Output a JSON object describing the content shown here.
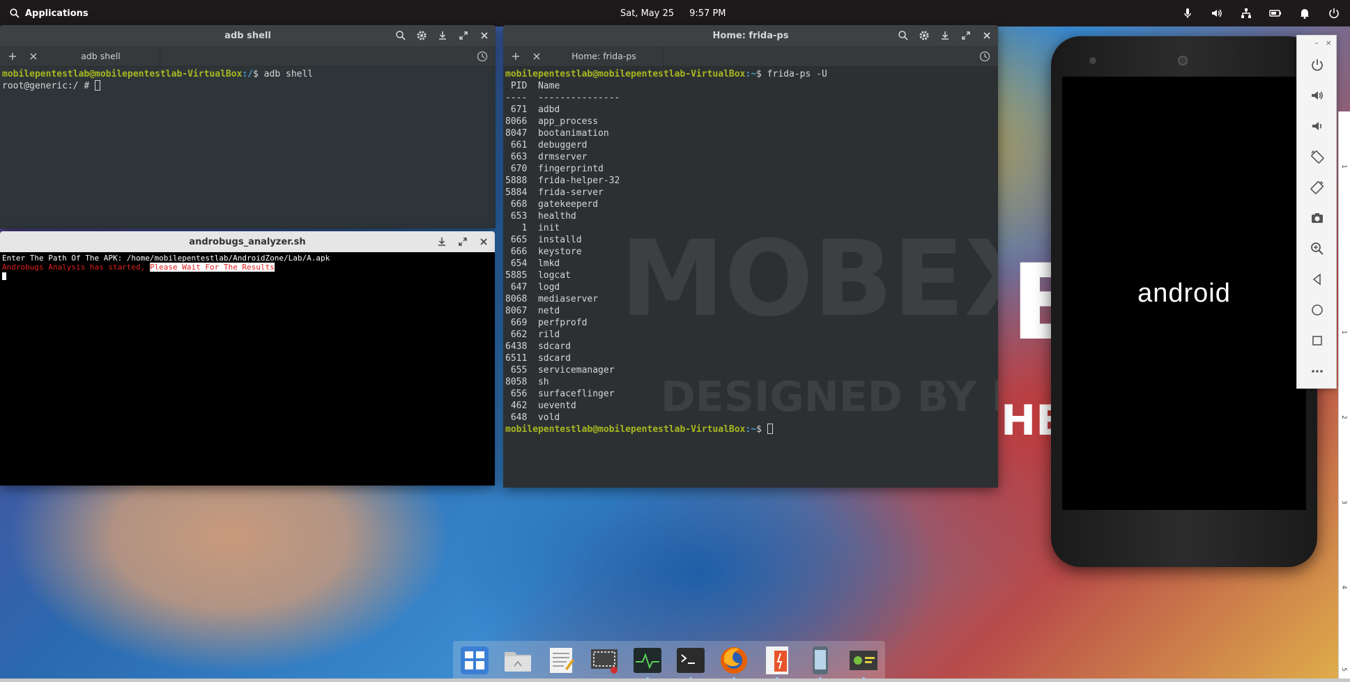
{
  "top_panel": {
    "apps_label": "Applications",
    "date": "Sat, May 25",
    "time": "9:57 PM",
    "tray_icons": [
      "microphone-icon",
      "volume-icon",
      "network-icon",
      "battery-icon",
      "notification-bell-icon",
      "power-icon"
    ]
  },
  "adb_window": {
    "title": "adb shell",
    "tab_label": "adb shell",
    "prompt_user": "mobilepentestlab@mobilepentestlab-VirtualBox",
    "prompt_path": ":/",
    "command": "$ adb shell",
    "root_prompt": "root@generic:/ # "
  },
  "andro_window": {
    "title": "androbugs_analyzer.sh",
    "line1": "Enter The Path Of The APK: /home/mobilepentestlab/AndroidZone/Lab/A.apk",
    "line2_red": "Androbugs Analysis has started, ",
    "line2_highlight": "Please Wait For The Results"
  },
  "frida_window": {
    "title": "Home: frida-ps",
    "tab_label": "Home: frida-ps",
    "prompt_user": "mobilepentestlab@mobilepentestlab-VirtualBox",
    "prompt_path": ":~",
    "command": "$ frida-ps -U",
    "header_pid": "PID",
    "header_name": "Name",
    "separator": "----  ---------------",
    "processes": [
      {
        "pid": "671",
        "name": "adbd"
      },
      {
        "pid": "8066",
        "name": "app_process"
      },
      {
        "pid": "8047",
        "name": "bootanimation"
      },
      {
        "pid": "661",
        "name": "debuggerd"
      },
      {
        "pid": "663",
        "name": "drmserver"
      },
      {
        "pid": "670",
        "name": "fingerprintd"
      },
      {
        "pid": "5888",
        "name": "frida-helper-32"
      },
      {
        "pid": "5884",
        "name": "frida-server"
      },
      {
        "pid": "668",
        "name": "gatekeeperd"
      },
      {
        "pid": "653",
        "name": "healthd"
      },
      {
        "pid": "1",
        "name": "init"
      },
      {
        "pid": "665",
        "name": "installd"
      },
      {
        "pid": "666",
        "name": "keystore"
      },
      {
        "pid": "654",
        "name": "lmkd"
      },
      {
        "pid": "5885",
        "name": "logcat"
      },
      {
        "pid": "647",
        "name": "logd"
      },
      {
        "pid": "8068",
        "name": "mediaserver"
      },
      {
        "pid": "8067",
        "name": "netd"
      },
      {
        "pid": "669",
        "name": "perfprofd"
      },
      {
        "pid": "662",
        "name": "rild"
      },
      {
        "pid": "6438",
        "name": "sdcard"
      },
      {
        "pid": "6511",
        "name": "sdcard"
      },
      {
        "pid": "655",
        "name": "servicemanager"
      },
      {
        "pid": "8058",
        "name": "sh"
      },
      {
        "pid": "656",
        "name": "surfaceflinger"
      },
      {
        "pid": "462",
        "name": "ueventd"
      },
      {
        "pid": "648",
        "name": "vold"
      }
    ],
    "end_prompt": "$ "
  },
  "desktop": {
    "watermark_main": "MOBEXL",
    "watermark_main_bright": "E",
    "watermark_sub": "DESIGNED BY ENCIP",
    "watermark_sub_bright": "HE"
  },
  "phone": {
    "screen_text": "android"
  },
  "emulator_toolbar": {
    "minimize": "–",
    "close": "×",
    "buttons": [
      "power-icon",
      "volume-up-icon",
      "volume-down-icon",
      "rotate-left-icon",
      "rotate-right-icon",
      "camera-icon",
      "zoom-icon",
      "back-icon",
      "home-icon",
      "overview-icon",
      "more-icon"
    ]
  },
  "ruler": {
    "numbers": [
      "1",
      "1",
      "2",
      "3",
      "4",
      "5"
    ]
  },
  "dock": {
    "items": [
      "multitasking-view-icon",
      "files-icon",
      "text-editor-icon",
      "screenshot-icon",
      "system-monitor-icon",
      "terminal-icon",
      "firefox-icon",
      "burp-suite-icon",
      "android-emulator-icon",
      "androbugs-icon"
    ],
    "colors": {
      "multitasking": "#3a7fd5",
      "files": "#d8d8d8",
      "editor": "#f2f2f2",
      "screenshot": "#444444",
      "monitor": "#1f2a2a",
      "terminal": "#2b2b2b",
      "firefox": "#e66000",
      "burp": "#e8542a",
      "emulator": "#5a6b78",
      "androbugs": "#3a3a3a"
    }
  }
}
